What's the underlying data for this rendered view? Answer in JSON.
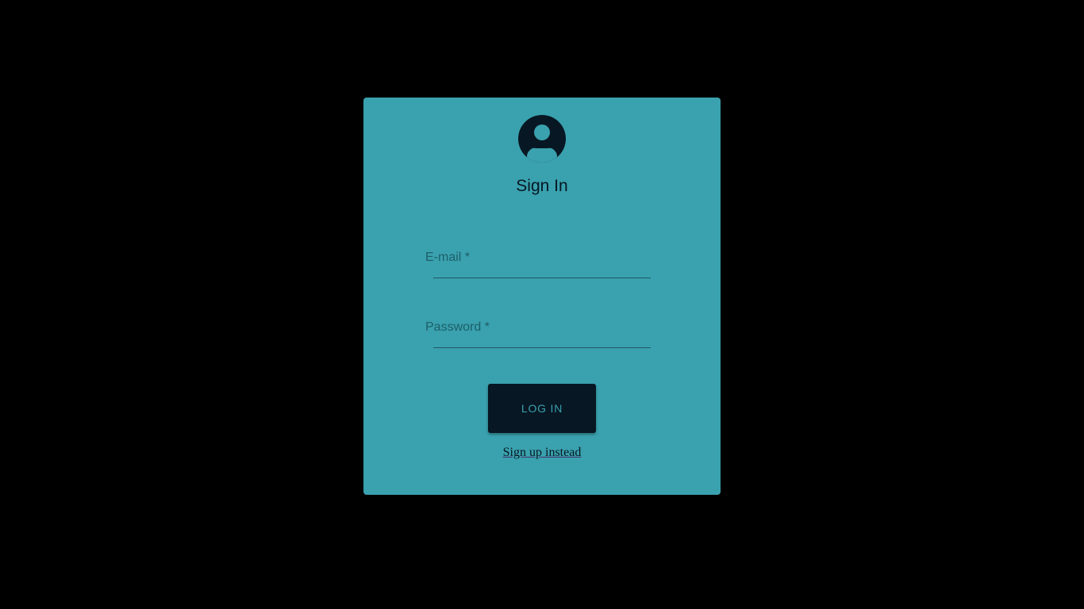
{
  "colors": {
    "page_background": "#000000",
    "card_background": "#3aa1ae",
    "dark": "#071723",
    "label": "#1c5f69"
  },
  "header": {
    "avatar_icon": "account-circle-icon",
    "title": "Sign In"
  },
  "form": {
    "email": {
      "label": "E-mail *",
      "value": ""
    },
    "password": {
      "label": "Password *",
      "value": ""
    },
    "login_label": "LOG IN",
    "signup_link": "Sign up instead"
  }
}
